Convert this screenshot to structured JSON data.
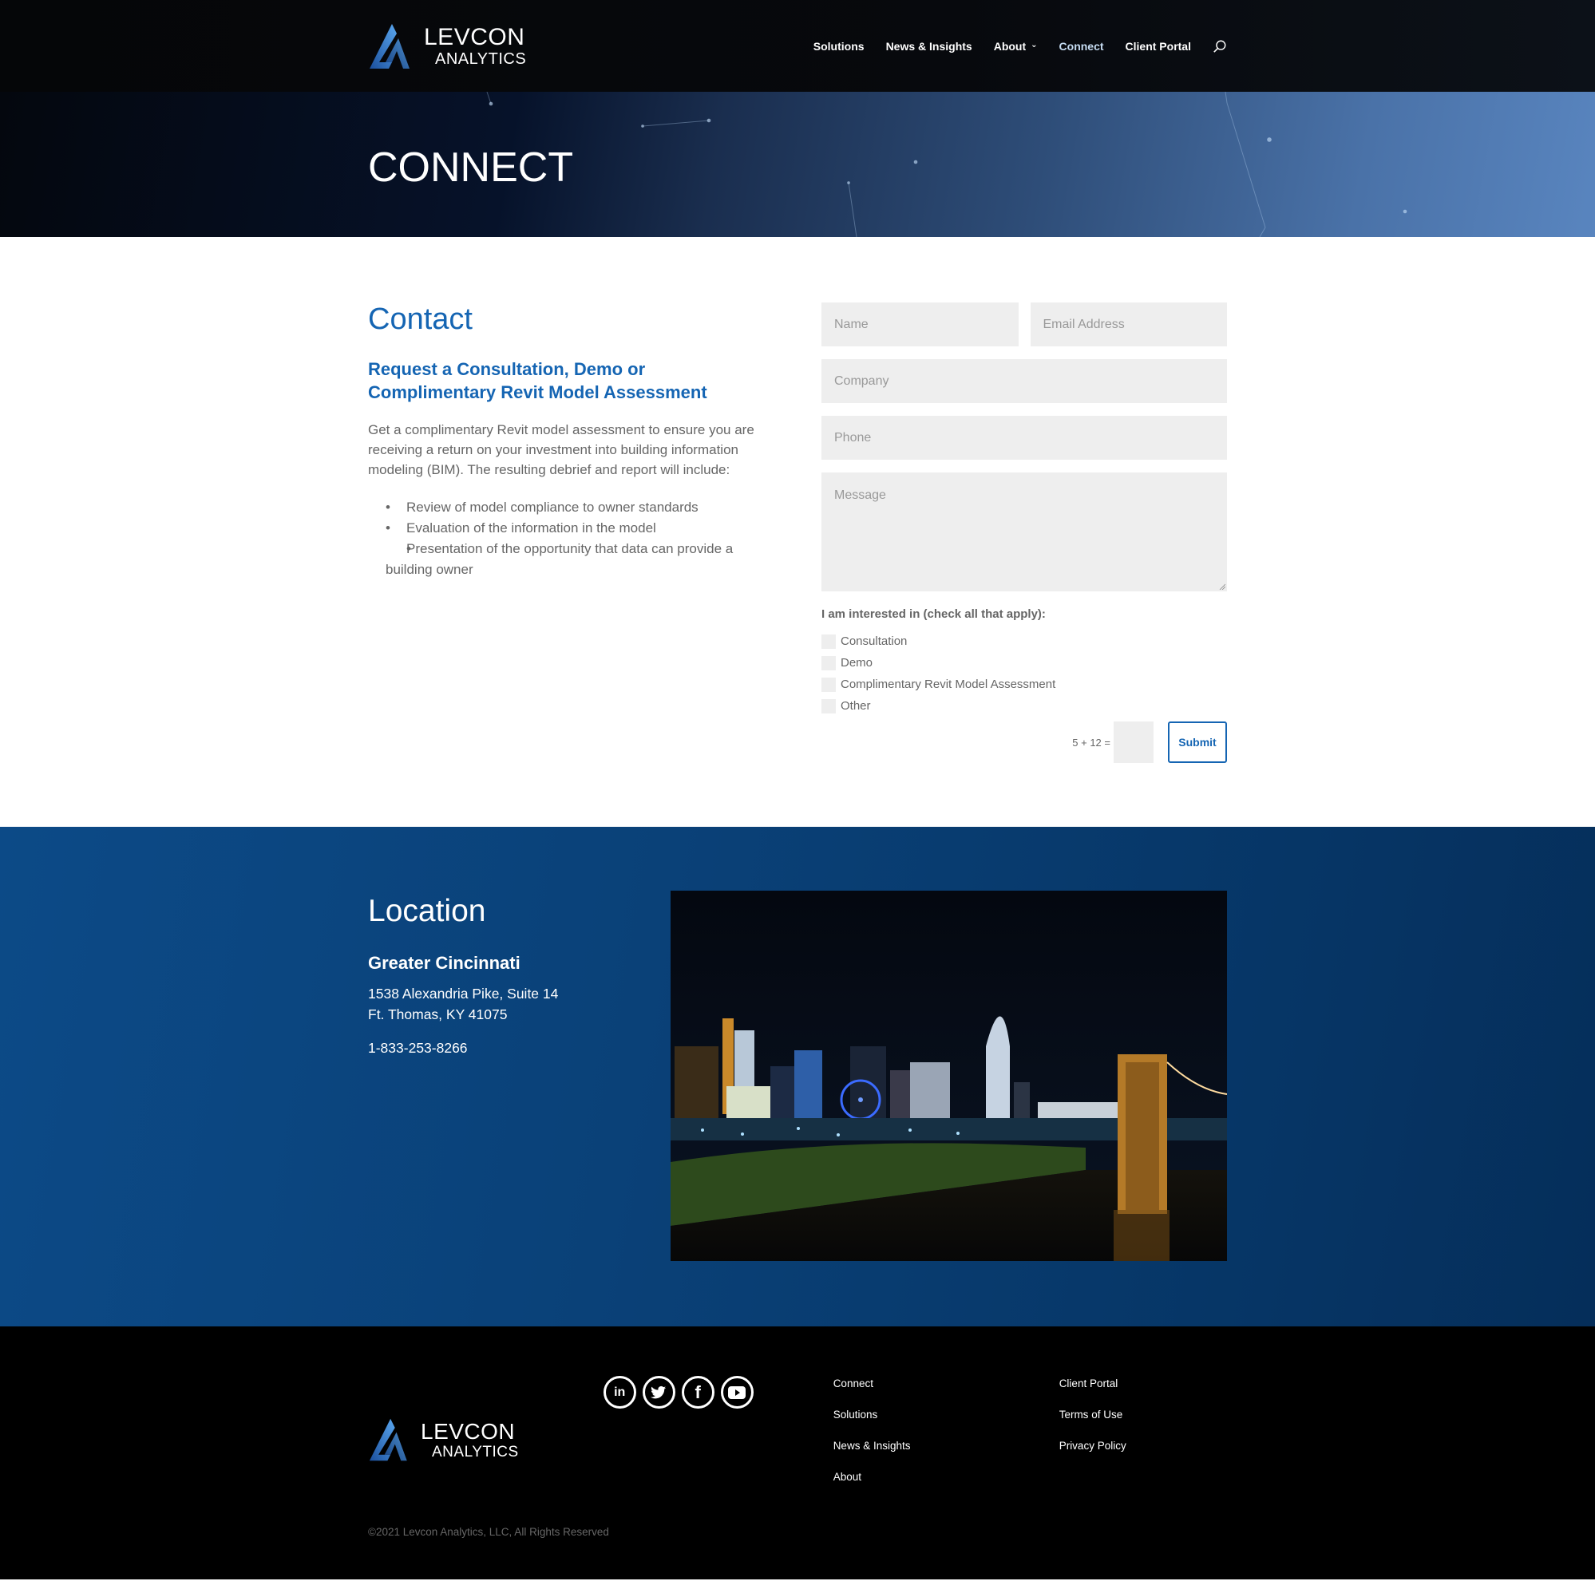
{
  "brand": {
    "name_line1": "LEVCON",
    "name_line2": "ANALYTICS",
    "colors": {
      "accent": "#1565b3",
      "logo_blue": "#2f7fd6",
      "location_bg": "#0a4178",
      "footer_bg": "#000000"
    }
  },
  "nav": {
    "items": [
      {
        "label": "Solutions"
      },
      {
        "label": "News & Insights"
      },
      {
        "label": "About",
        "has_dropdown": true
      },
      {
        "label": "Connect",
        "active": true
      },
      {
        "label": "Client Portal"
      }
    ],
    "search_icon": "search-icon"
  },
  "hero": {
    "title": "CONNECT"
  },
  "contact": {
    "heading": "Contact",
    "subheading": "Request a Consultation, Demo or Complimentary Revit Model Assessment",
    "intro": "Get a complimentary Revit model assessment to ensure you are receiving a return on your investment into building information modeling (BIM). The resulting debrief and report will include:",
    "bullets": [
      "Review of model compliance to owner standards",
      "Evaluation of the information in the model",
      "Presentation of the opportunity that data can provide a building owner"
    ]
  },
  "form": {
    "name_placeholder": "Name",
    "email_placeholder": "Email Address",
    "company_placeholder": "Company",
    "phone_placeholder": "Phone",
    "message_placeholder": "Message",
    "interest_label": "I am interested in (check all that apply):",
    "options": [
      {
        "label": "Consultation",
        "checked": false
      },
      {
        "label": "Demo",
        "checked": false
      },
      {
        "label": "Complimentary Revit Model Assessment",
        "checked": false
      },
      {
        "label": "Other",
        "checked": false
      }
    ],
    "captcha_question": "5 + 12 =",
    "captcha_value": "",
    "submit_label": "Submit"
  },
  "location": {
    "heading": "Location",
    "region": "Greater Cincinnati",
    "address_line1": "1538 Alexandria Pike, Suite 14",
    "address_line2": "Ft. Thomas, KY 41075",
    "phone": "1-833-253-8266",
    "image_alt": "Cincinnati skyline at night"
  },
  "footer": {
    "social": [
      {
        "name": "linkedin-icon",
        "glyph": "in"
      },
      {
        "name": "twitter-icon"
      },
      {
        "name": "facebook-icon",
        "glyph": "f"
      },
      {
        "name": "youtube-icon"
      }
    ],
    "col1": [
      {
        "label": "Connect"
      },
      {
        "label": "Solutions"
      },
      {
        "label": "News & Insights"
      },
      {
        "label": "About"
      }
    ],
    "col2": [
      {
        "label": "Client Portal"
      },
      {
        "label": "Terms of Use"
      },
      {
        "label": "Privacy Policy"
      }
    ],
    "copyright": "©2021 Levcon Analytics, LLC, All Rights Reserved"
  }
}
